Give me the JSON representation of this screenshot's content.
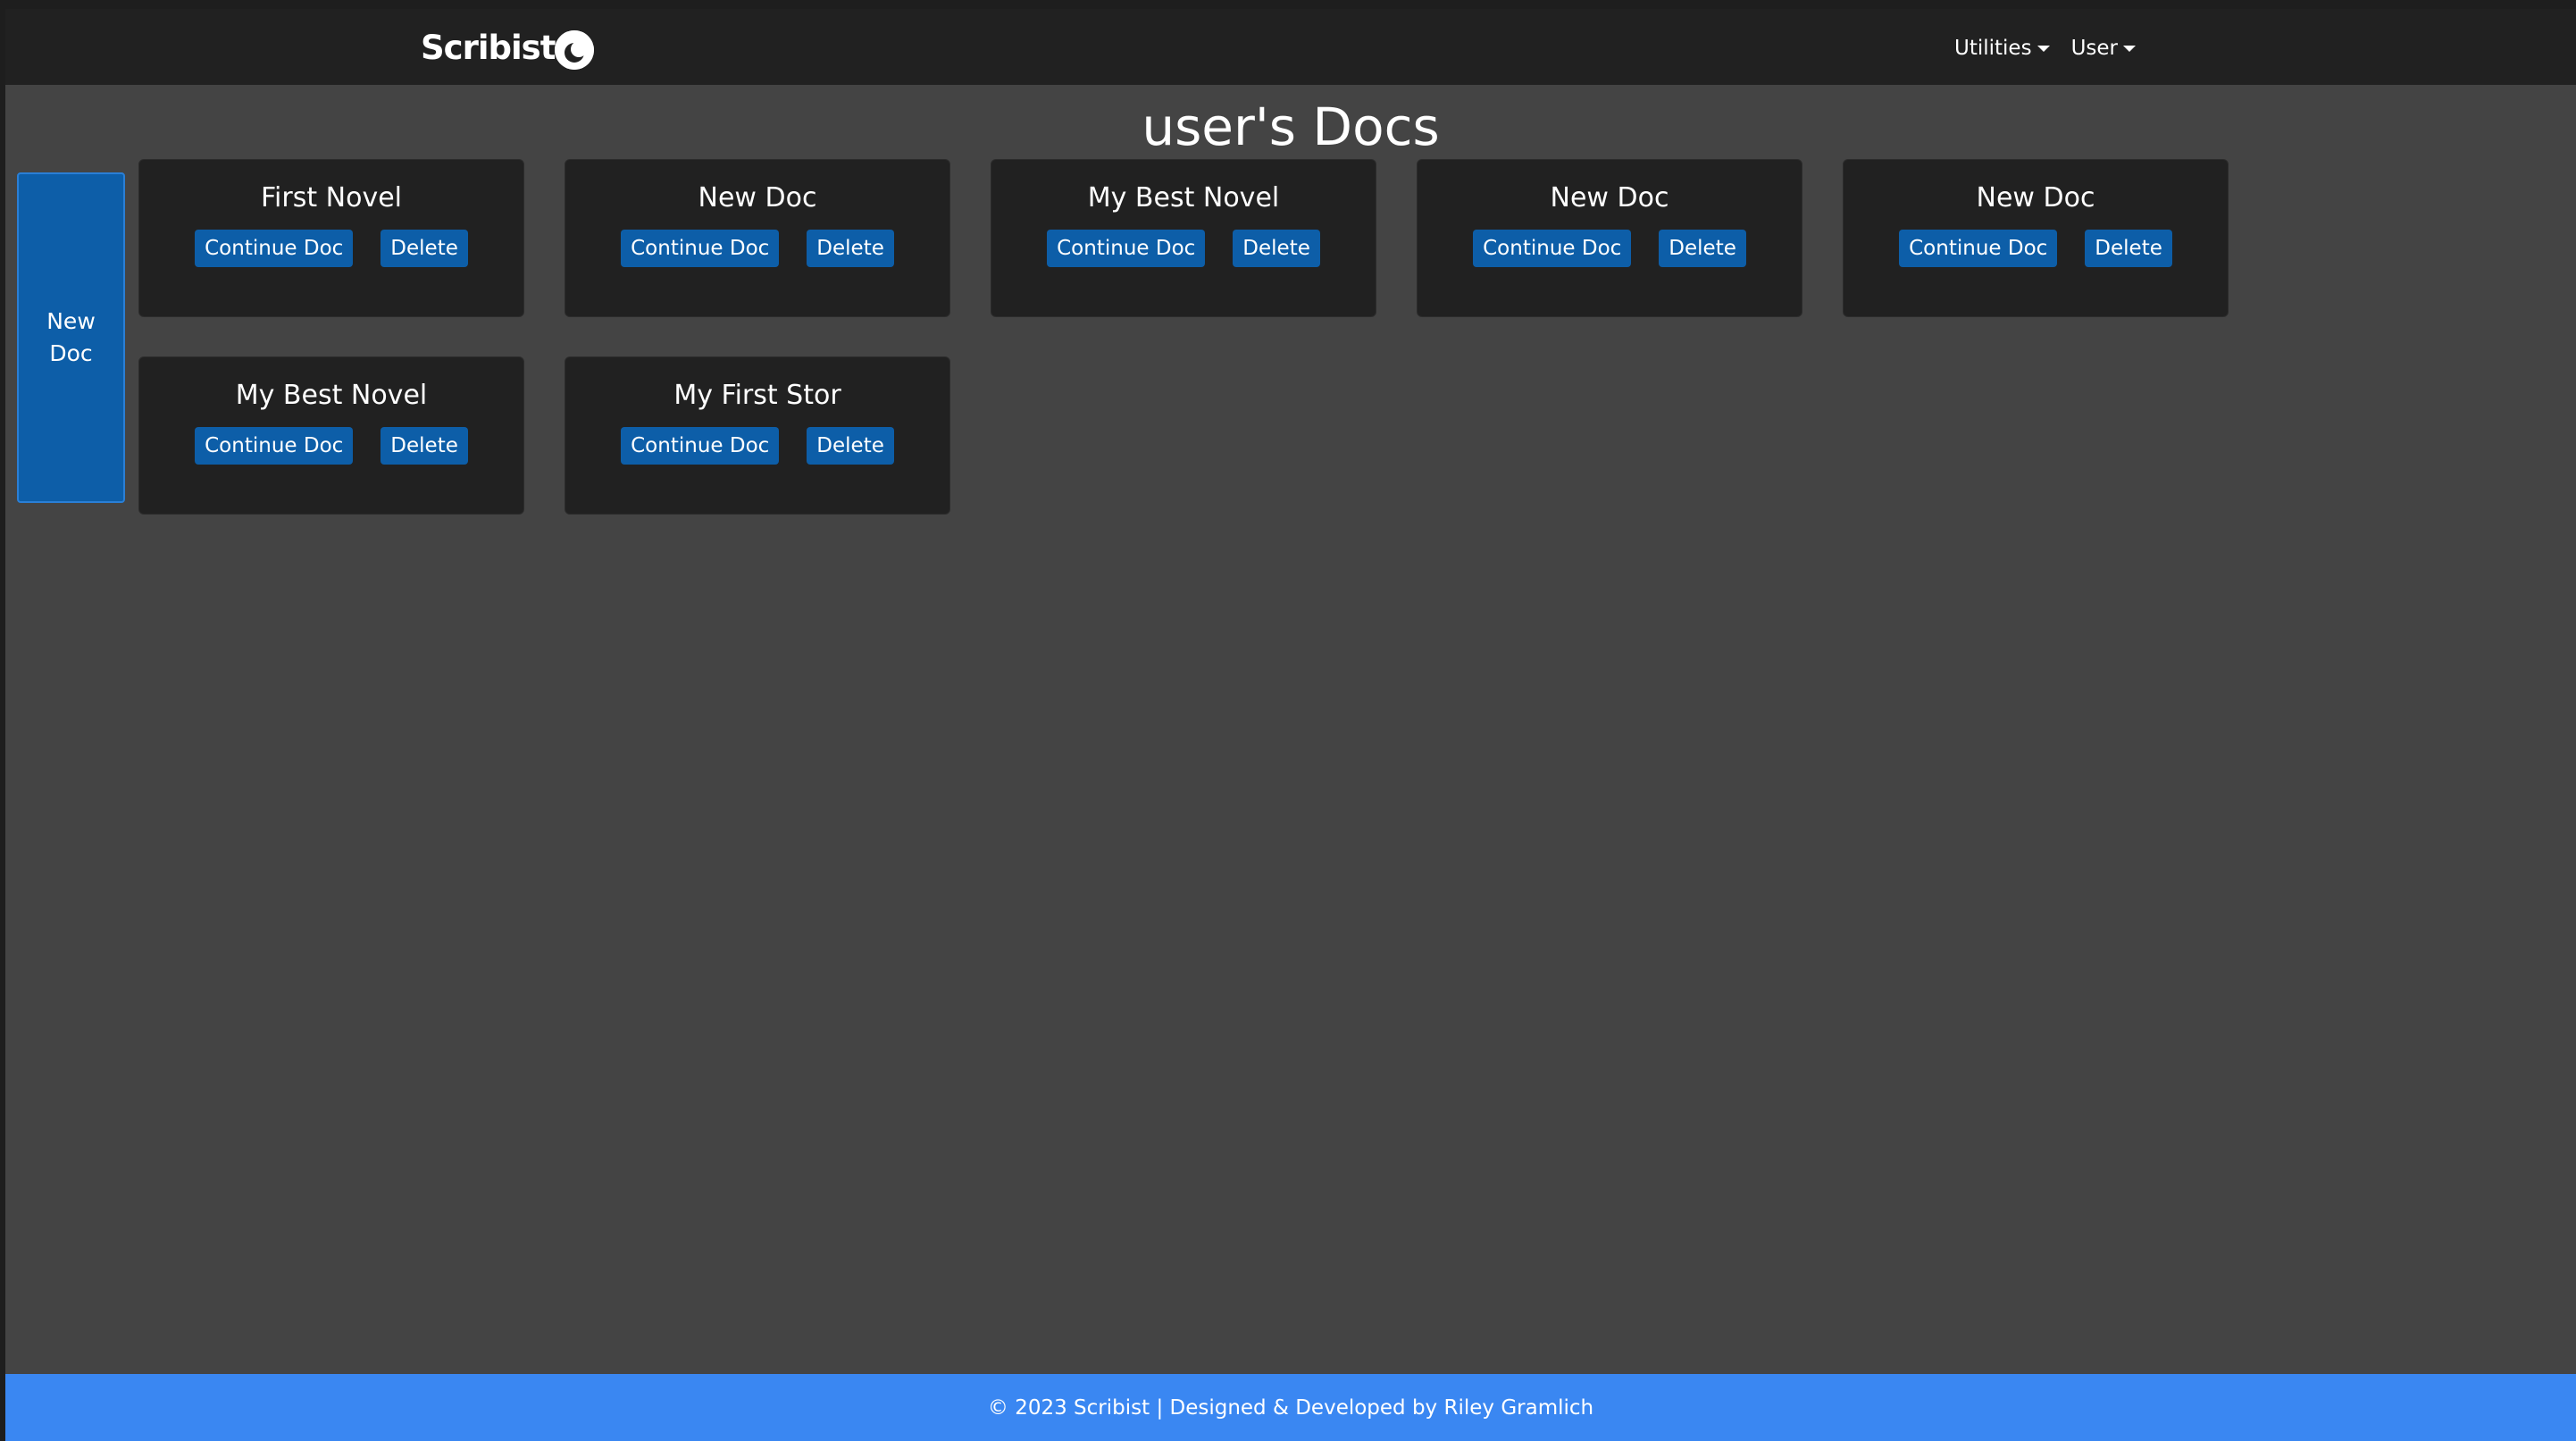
{
  "navbar": {
    "brand": "Scribist",
    "theme_toggle_icon": "moon-icon",
    "menus": [
      {
        "label": "Utilities"
      },
      {
        "label": "User"
      }
    ]
  },
  "page_title": "user's Docs",
  "new_doc_button": "New Doc",
  "docs": [
    {
      "title": "First Novel",
      "continue_label": "Continue Doc",
      "delete_label": "Delete"
    },
    {
      "title": "New Doc",
      "continue_label": "Continue Doc",
      "delete_label": "Delete"
    },
    {
      "title": "My Best Novel",
      "continue_label": "Continue Doc",
      "delete_label": "Delete"
    },
    {
      "title": "New Doc",
      "continue_label": "Continue Doc",
      "delete_label": "Delete"
    },
    {
      "title": "New Doc",
      "continue_label": "Continue Doc",
      "delete_label": "Delete"
    },
    {
      "title": "My Best Novel",
      "continue_label": "Continue Doc",
      "delete_label": "Delete"
    },
    {
      "title": "My First Stor",
      "continue_label": "Continue Doc",
      "delete_label": "Delete"
    }
  ],
  "footer": {
    "text": "© 2023 Scribist | Designed & Developed by Riley Gramlich"
  },
  "colors": {
    "navbar_bg": "#212121",
    "page_bg": "#444444",
    "card_bg": "#212121",
    "button_bg": "#0d5ea8",
    "footer_bg": "#3a87f2"
  }
}
